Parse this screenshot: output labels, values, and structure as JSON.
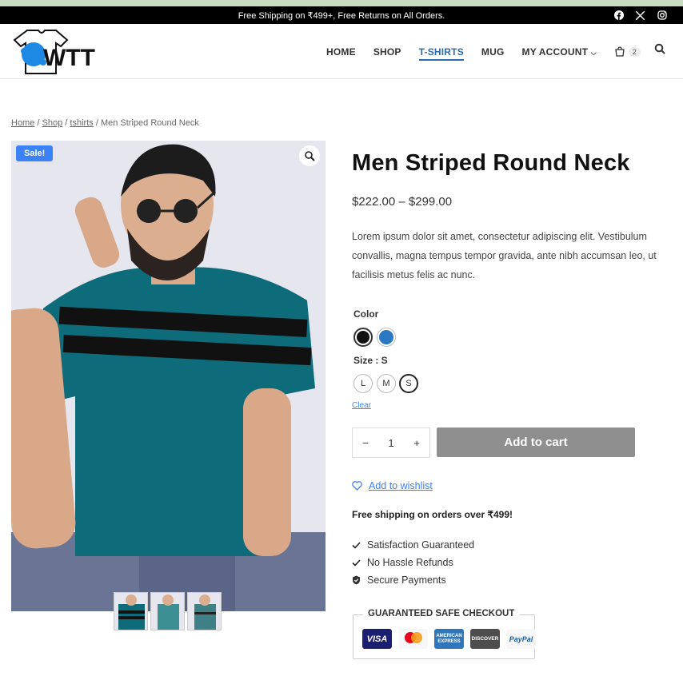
{
  "announcement": {
    "text": "Free Shipping on ₹499+, Free Returns on All Orders."
  },
  "social": {
    "facebook": "facebook-icon",
    "x": "x-icon",
    "instagram": "instagram-icon"
  },
  "header": {
    "logo_text": "WTT",
    "nav": [
      {
        "label": "HOME"
      },
      {
        "label": "SHOP"
      },
      {
        "label": "T-SHIRTS"
      },
      {
        "label": "MUG"
      },
      {
        "label": "MY ACCOUNT"
      }
    ],
    "cart_count": "2"
  },
  "breadcrumb": {
    "home": "Home",
    "shop": "Shop",
    "tshirts": "tshirts",
    "current": "Men Striped Round Neck",
    "sep": "/"
  },
  "product": {
    "sale_badge": "Sale!",
    "title": "Men Striped Round Neck",
    "price": "$222.00 – $299.00",
    "description": "Lorem ipsum dolor sit amet, consectetur adipiscing elit. Vestibulum convallis, magna tempus tempor gravida, ante nibh accumsan leo, ut facilisis metus felis ac nunc.",
    "color_label": "Color",
    "colors": [
      "#111111",
      "#2a78c2"
    ],
    "size_label": "Size : S",
    "sizes": [
      "L",
      "M",
      "S"
    ],
    "selected_size": "S",
    "clear_label": "Clear",
    "quantity": "1",
    "qty_minus": "−",
    "qty_plus": "+",
    "add_to_cart": "Add to cart",
    "wishlist": "Add to wishlist",
    "free_shipping": "Free shipping on orders over ₹499!",
    "features": [
      "Satisfaction Guaranteed",
      "No Hassle Refunds",
      "Secure Payments"
    ],
    "safe_checkout_title": "GUARANTEED SAFE CHECKOUT",
    "payment_cards": [
      "VISA",
      "mastercard",
      "AMERICAN EXPRESS",
      "DISCOVER",
      "PayPal"
    ]
  },
  "colors": {
    "accent": "#2b6cb0",
    "sale": "#3b82f6",
    "button": "#8f8f8f",
    "shirt": "#0e6b7a"
  }
}
